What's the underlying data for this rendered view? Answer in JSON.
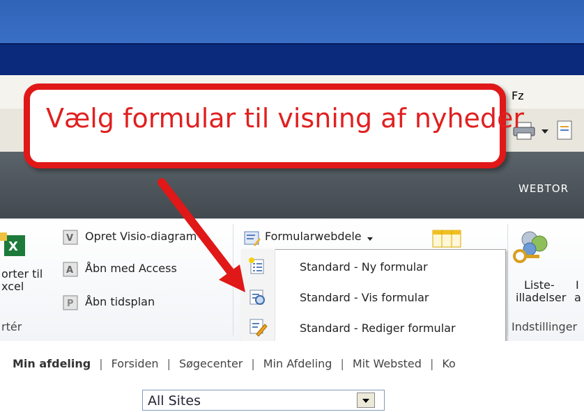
{
  "window": {
    "partial_text": "Fz"
  },
  "ribbon": {
    "tab_label": "WEBTOR",
    "export_group": {
      "items": [
        {
          "icon": "visio-icon",
          "label": "Opret Visio-diagram"
        },
        {
          "icon": "access-icon",
          "label": "Åbn med Access"
        },
        {
          "icon": "project-icon",
          "label": "Åbn tidsplan"
        }
      ],
      "excel_label_line1": "orter til",
      "excel_label_line2": "xcel",
      "group_label": "rtér"
    },
    "form_webparts": {
      "label": "Formularwebdele",
      "menu_items": [
        {
          "icon": "new-form-icon",
          "label": "Standard - Ny formular"
        },
        {
          "icon": "view-form-icon",
          "label": "Standard - Vis formular"
        },
        {
          "icon": "edit-form-icon",
          "label": "Standard - Rediger formular"
        }
      ]
    },
    "settings_group": {
      "list_permissions_line1": "Liste-",
      "list_permissions_line2": "illadelser",
      "next_item_line1": "I",
      "next_item_line2": "a",
      "group_label": "Indstillinger"
    }
  },
  "nav": {
    "items": [
      "Min afdeling",
      "Forsiden",
      "Søgecenter",
      "Min Afdeling",
      "Mit Websted",
      "Ko"
    ]
  },
  "search": {
    "scope_value": "All Sites"
  },
  "callout": {
    "text": "Vælg formular til visning af nyheder"
  },
  "colors": {
    "callout_red": "#e01818",
    "title_blue": "#2f64b8",
    "dark_blue": "#0b2a7c",
    "ribbon_gray": "#4b5359"
  }
}
